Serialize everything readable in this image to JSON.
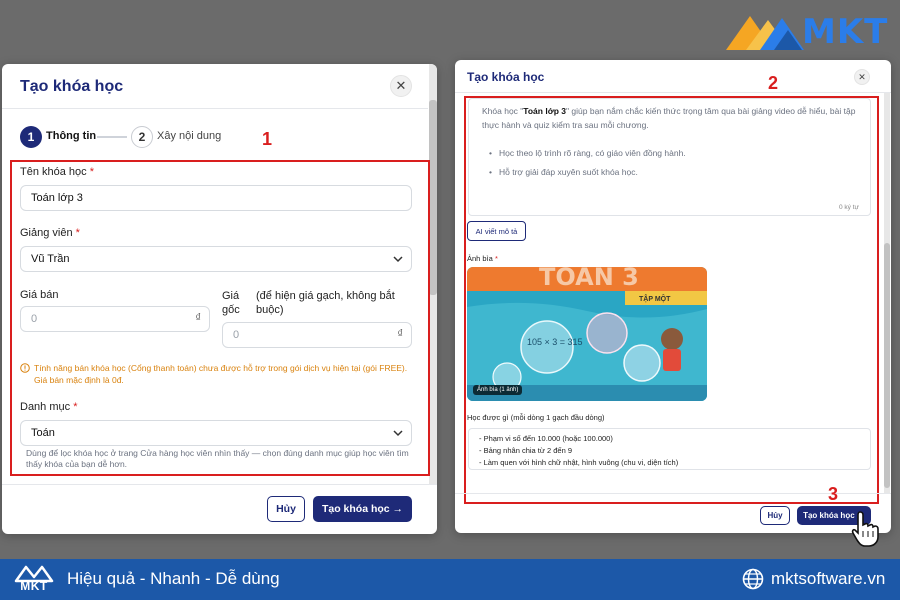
{
  "brand": {
    "name": "MKT"
  },
  "dialog1": {
    "title": "Tạo khóa học",
    "close": "✕",
    "steps": [
      {
        "num": "1",
        "label": "Thông tin"
      },
      {
        "num": "2",
        "label": "Xây nội dung"
      }
    ],
    "fields": {
      "name_label": "Tên khóa học",
      "name_value": "Toán lớp 3",
      "teacher_label": "Giảng viên",
      "teacher_value": "Vũ Trần",
      "price_label": "Giá bán",
      "price_value": "0",
      "orig_label": "Giá gốc",
      "orig_note": "(để hiện giá gạch, không bắt buộc)",
      "orig_value": "0",
      "currency": "₫",
      "required": "*",
      "warning": "Tính năng bán khóa học (Cổng thanh toán) chưa được hỗ trợ trong gói dịch vụ hiện tại (gói FREE). Giá bán mặc định là 0đ.",
      "category_label": "Danh mục",
      "category_value": "Toán",
      "category_hint": "Dùng để lọc khóa học ở trang Cửa hàng học viên nhìn thấy — chọn đúng danh mục giúp học viên tìm thấy khóa của bạn dễ hơn."
    },
    "cancel": "Hủy",
    "submit": "Tạo khóa học →"
  },
  "dialog2": {
    "title": "Tạo khóa học",
    "close": "✕",
    "desc_pre": "Khóa học \"",
    "desc_bold": "Toán lớp 3",
    "desc_post": "\" giúp bạn nắm chắc kiến thức trọng tâm qua bài giảng video dễ hiểu, bài tập thực hành và quiz kiểm tra sau mỗi chương.",
    "bullets": [
      "Học theo lộ trình rõ ràng, có giáo viên đồng hành.",
      "Hỗ trợ giải đáp xuyên suốt khóa học."
    ],
    "char_count": "0 ký tự",
    "ai_button": "AI viết mô tả",
    "cover_label": "Ảnh bìa",
    "cover_title": "TOÁN 3",
    "cover_ribbon": "TẬP MỘT",
    "cover_math": "105 × 3 = 315",
    "cover_badge": "Ảnh bìa (1 ảnh)",
    "learn_label": "Học được gì (mỗi dòng 1 gạch đầu dòng)",
    "learn_lines": [
      "- Phạm vi số đến 10.000 (hoặc 100.000)",
      "- Bảng nhân chia từ 2 đến 9",
      "- Làm quen với hình chữ nhật, hình vuông (chu vi, diện tích)"
    ],
    "cancel": "Hủy",
    "submit": "Tạo khóa học →"
  },
  "annotations": [
    "1",
    "2",
    "3"
  ],
  "footer": {
    "logo": "MKT",
    "slogan": "Hiệu quả - Nhanh - Dễ dùng",
    "website": "mktsoftware.vn"
  },
  "colors": {
    "primary": "#1e2a78",
    "highlight": "#d91e1e",
    "footer": "#1c58a8",
    "warning": "#d9820e"
  }
}
